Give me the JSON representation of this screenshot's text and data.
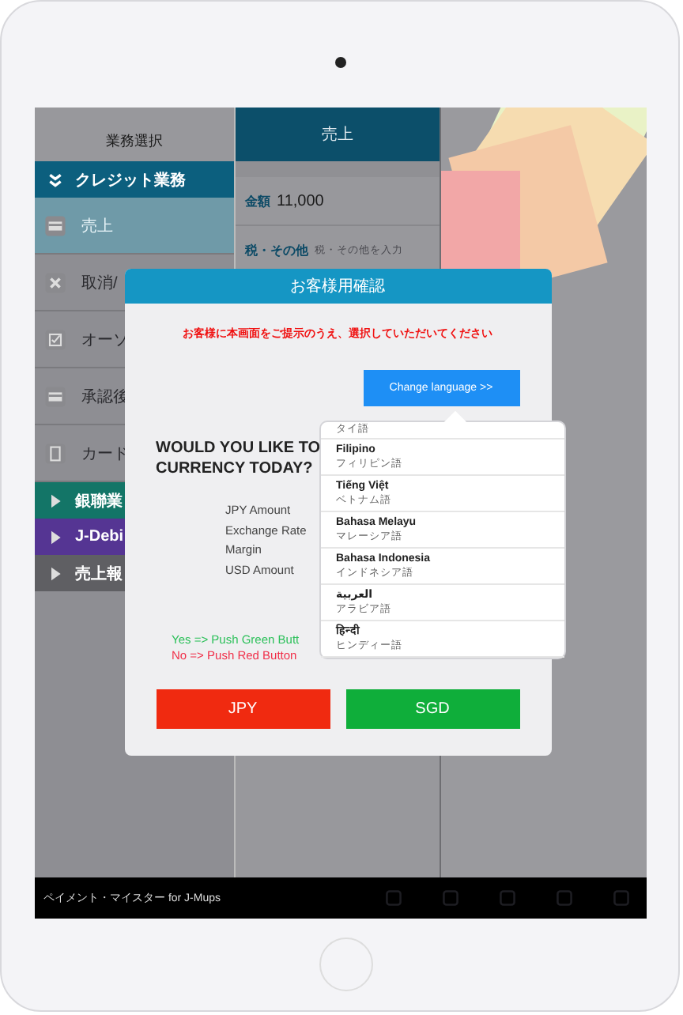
{
  "sidebar": {
    "title": "業務選択",
    "sections": [
      {
        "label": "クレジット業務",
        "expanded": true,
        "color": "#0c5f7e",
        "items": [
          {
            "label": "売上",
            "selected": true
          },
          {
            "label": "取消/",
            "selected": false
          },
          {
            "label": "オーソ",
            "selected": false
          },
          {
            "label": "承認後",
            "selected": false
          },
          {
            "label": "カード",
            "selected": false
          }
        ]
      },
      {
        "label": "銀聯業",
        "expanded": false,
        "color": "#137567"
      },
      {
        "label": "J-Debi",
        "expanded": false,
        "color": "#553593"
      },
      {
        "label": "売上報",
        "expanded": false,
        "color": "#5f5f63"
      }
    ]
  },
  "main": {
    "title": "売上",
    "fields": [
      {
        "label": "金額",
        "value": "11,000"
      },
      {
        "label": "税・その他",
        "placeholder": "税・その他を入力"
      }
    ]
  },
  "footer": {
    "app_name": "ペイメント・マイスター for J-Mups"
  },
  "dialog": {
    "title": "お客様用確認",
    "notice": "お客様に本画面をご提示のうえ、選択していただいてください",
    "language_button": "Change language >>",
    "question": [
      "WOULD YOU LIKE TO",
      "CURRENCY TODAY?"
    ],
    "rows": [
      "JPY Amount",
      "Exchange Rate",
      "Margin",
      "USD Amount"
    ],
    "hint_yes": "Yes => Push Green Butt",
    "hint_no": "No => Push Red Button",
    "buttons": [
      {
        "label": "JPY",
        "kind": "no"
      },
      {
        "label": "SGD",
        "kind": "yes"
      }
    ],
    "languages": [
      {
        "native": "タイ語"
      },
      {
        "label": "Filipino",
        "native": "フィリピン語"
      },
      {
        "label": "Tiếng Việt",
        "native": "ベトナム語"
      },
      {
        "label": "Bahasa Melayu",
        "native": "マレーシア語"
      },
      {
        "label": "Bahasa Indonesia",
        "native": "インドネシア語"
      },
      {
        "label": "العربية",
        "native": "アラビア語"
      },
      {
        "label": "हिन्दी",
        "native": "ヒンディー語"
      }
    ]
  }
}
